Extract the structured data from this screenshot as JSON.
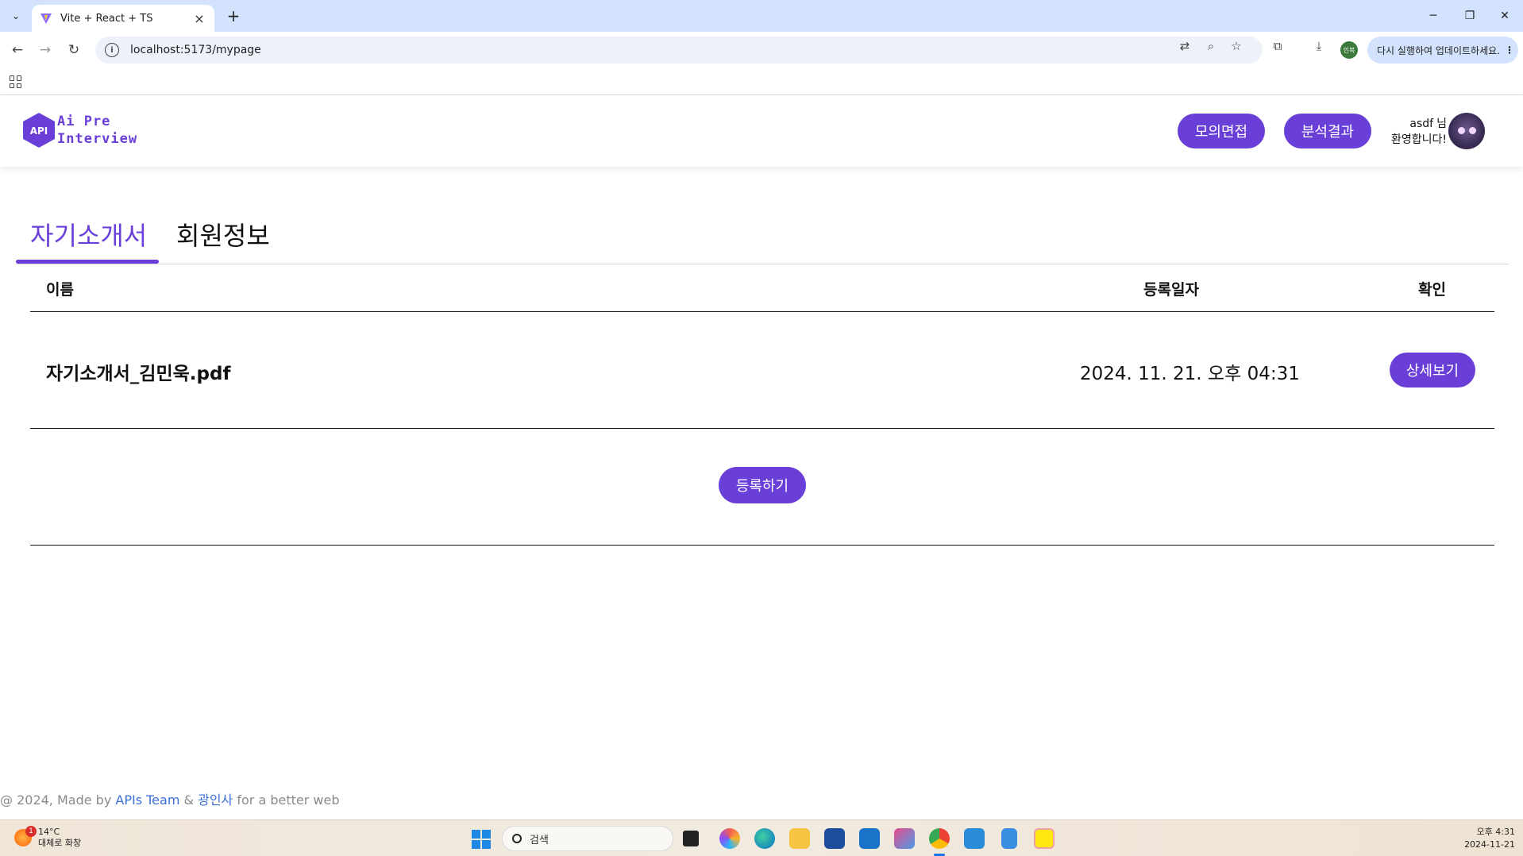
{
  "browser": {
    "tab_title": "Vite + React + TS",
    "url": "localhost:5173/mypage",
    "update_label": "다시 실행하여 업데이트하세요.",
    "profile_label": "인복"
  },
  "header": {
    "logo_line1": "Ai Pre",
    "logo_line2": "Interview",
    "logo_badge": "API",
    "mock_interview_button": "모의면접",
    "analysis_button": "분석결과",
    "username": "asdf",
    "honorific": "님",
    "welcome": "환영합니다!"
  },
  "tabs": {
    "intro": "자기소개서",
    "member_info": "회원정보",
    "active": "intro"
  },
  "table": {
    "columns": [
      "이름",
      "등록일자",
      "확인"
    ],
    "rows": [
      {
        "name": "자기소개서_김민욱.pdf",
        "date": "2024. 11. 21. 오후 04:31",
        "action": "상세보기"
      }
    ],
    "register_button": "등록하기"
  },
  "footer": {
    "prefix": "@ 2024, Made by",
    "team": "APIs Team",
    "amp": "&",
    "org": "광인사",
    "suffix": "for a better web"
  },
  "taskbar": {
    "temperature": "14°C",
    "weather": "대체로 화창",
    "weather_badge": "1",
    "search_placeholder": "검색",
    "time": "오후 4:31",
    "date": "2024-11-21"
  },
  "colors": {
    "brand": "#6a3fd8",
    "link": "#3b6fd8"
  }
}
